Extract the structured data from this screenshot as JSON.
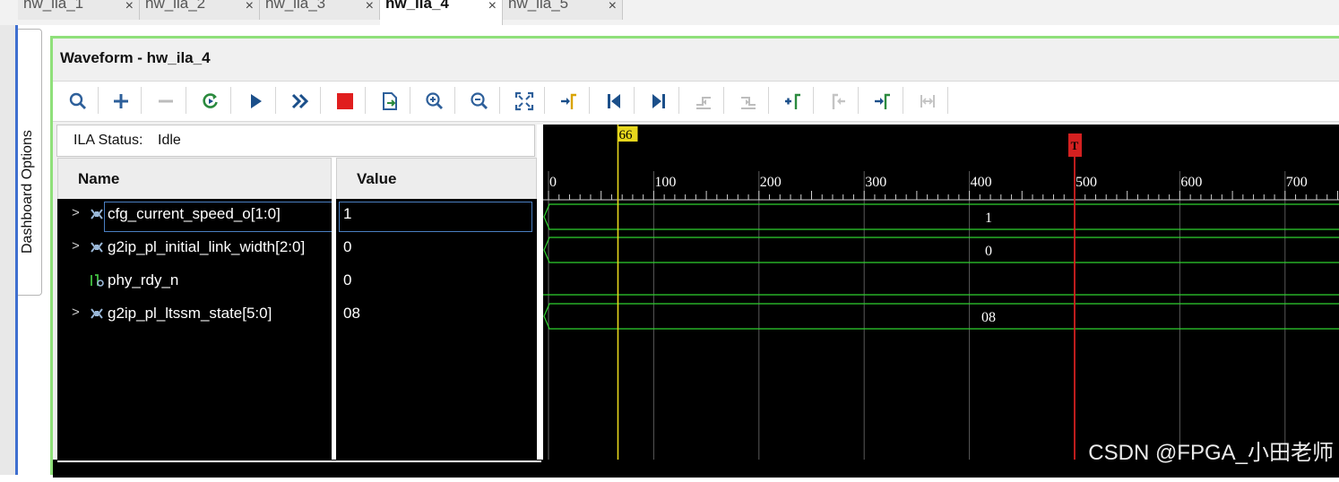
{
  "tabs": [
    {
      "label": "hw_ila_1",
      "close": "×",
      "active": false
    },
    {
      "label": "hw_ila_2",
      "close": "×",
      "active": false
    },
    {
      "label": "hw_ila_3",
      "close": "×",
      "active": false
    },
    {
      "label": "hw_ila_4",
      "close": "×",
      "active": true
    },
    {
      "label": "hw_ila_5",
      "close": "×",
      "active": false
    }
  ],
  "sidebar": {
    "dashboard_label": "Dashboard Options"
  },
  "window": {
    "title": "Waveform - hw_ila_4"
  },
  "toolbar": {
    "buttons": [
      "search-icon",
      "add-icon",
      "remove-icon",
      "run-trigger-icon",
      "run-icon",
      "run-immediate-icon",
      "stop-icon",
      "export-icon",
      "zoom-in-icon",
      "zoom-out-icon",
      "zoom-fit-icon",
      "go-to-cursor-icon",
      "go-to-start-icon",
      "go-to-end-icon",
      "previous-transition-icon",
      "next-transition-icon",
      "add-marker-icon",
      "previous-marker-icon",
      "next-marker-icon",
      "swap-cursor-icon"
    ],
    "disabled": [
      "remove-icon",
      "previous-transition-icon",
      "next-transition-icon",
      "previous-marker-icon",
      "swap-cursor-icon"
    ]
  },
  "status": {
    "label": "ILA Status:",
    "value": "Idle"
  },
  "columns": {
    "name": "Name",
    "value": "Value"
  },
  "signals": [
    {
      "name": "cfg_current_speed_o[1:0]",
      "value": "1",
      "bus": true,
      "wave_label": "1"
    },
    {
      "name": "g2ip_pl_initial_link_width[2:0]",
      "value": "0",
      "bus": true,
      "wave_label": "0"
    },
    {
      "name": "phy_rdy_n",
      "value": "0",
      "bus": false,
      "wave_label": ""
    },
    {
      "name": "g2ip_pl_ltssm_state[5:0]",
      "value": "08",
      "bus": true,
      "wave_label": "08"
    }
  ],
  "timeline": {
    "ticks": [
      "0",
      "100",
      "200",
      "300",
      "400",
      "500",
      "600",
      "700"
    ],
    "cursor": "66",
    "trigger": "T",
    "cursor_sample": 66,
    "trigger_sample": 500
  },
  "colors": {
    "wave": "#2fd12f",
    "cursor": "#e6d61c",
    "trigger": "#d42020",
    "panel_border": "#8fe07a"
  },
  "watermark": "CSDN @FPGA_小田老师"
}
